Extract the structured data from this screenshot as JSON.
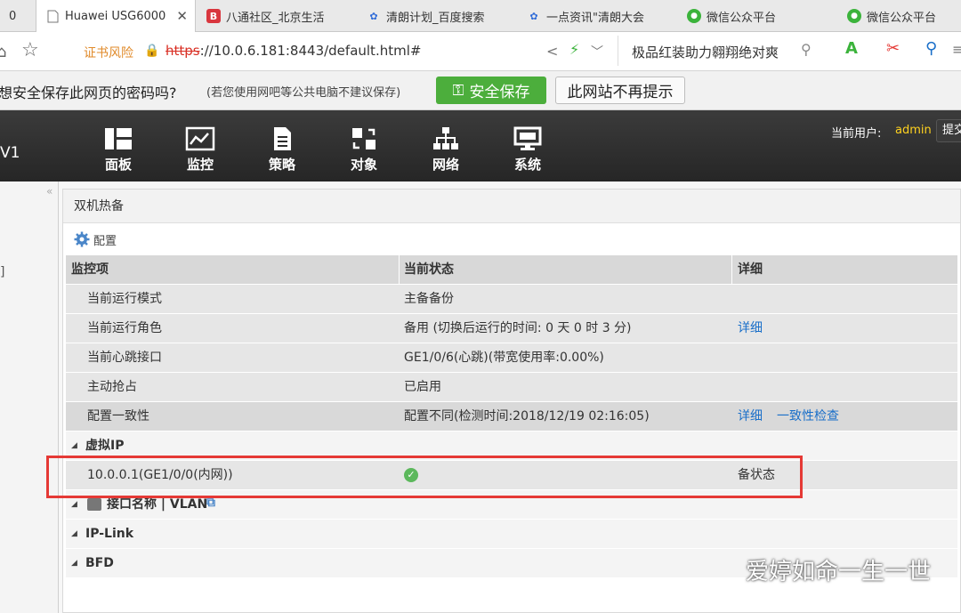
{
  "browser": {
    "tabs": [
      {
        "label": "0",
        "icon": "partial-tab-icon"
      },
      {
        "label": "Huawei USG6000",
        "icon": "page-icon",
        "active": true
      },
      {
        "label": "八通社区_北京生活",
        "icon": "b-logo-icon"
      },
      {
        "label": "清朗计划_百度搜索",
        "icon": "baidu-paw-icon"
      },
      {
        "label": "一点资讯\"清朗大会",
        "icon": "baidu-paw-icon"
      },
      {
        "label": "微信公众平台",
        "icon": "wechat-icon"
      },
      {
        "label": "微信公众平台",
        "icon": "wechat-icon"
      }
    ],
    "address": {
      "cert_warning": "证书风险",
      "scheme": "https",
      "url_rest": "://10.0.6.181:8443/default.html#",
      "search_text": "极品红装助力翱翔绝对爽"
    },
    "password_bar": {
      "question": "想安全保存此网页的密码吗?",
      "hint": "(若您使用网吧等公共电脑不建议保存)",
      "save_button": "安全保存",
      "never_button": "此网站不再提示"
    }
  },
  "app": {
    "version_fragment": "V1",
    "nav": [
      {
        "label": "面板",
        "icon": "dashboard-icon"
      },
      {
        "label": "监控",
        "icon": "monitor-chart-icon"
      },
      {
        "label": "策略",
        "icon": "policy-document-icon"
      },
      {
        "label": "对象",
        "icon": "object-icon"
      },
      {
        "label": "网络",
        "icon": "network-tree-icon"
      },
      {
        "label": "系统",
        "icon": "system-monitor-icon"
      }
    ],
    "user_label": "当前用户:",
    "user_name": "admin",
    "submit_fragment": "提交",
    "sidebar_fragment": "]"
  },
  "panel": {
    "title": "双机热备",
    "config_label": "配置",
    "headers": [
      "监控项",
      "当前状态",
      "详细"
    ],
    "rows": [
      {
        "item": "当前运行模式",
        "status": "主备备份",
        "detail": ""
      },
      {
        "item": "当前运行角色",
        "status": "备用 (切换后运行的时间: 0 天 0 时 3 分)",
        "detail": "详细"
      },
      {
        "item": "当前心跳接口",
        "status": "GE1/0/6(心跳)(带宽使用率:0.00%)",
        "detail": ""
      },
      {
        "item": "主动抢占",
        "status": "已启用",
        "detail": ""
      },
      {
        "item": "配置一致性",
        "status": "配置不同(检测时间:2018/12/19 02:16:05)",
        "detail": "详细",
        "detail2": "一致性检查"
      }
    ],
    "groups": {
      "vip": "虚拟IP",
      "vip_row": {
        "item": "10.0.0.1(GE1/0/0(内网))",
        "status_icon": "check-circle-icon",
        "detail": "备状态"
      },
      "iface": "接口名称 | VLAN",
      "iplink": "IP-Link",
      "bfd": "BFD"
    }
  },
  "watermark": "爱婷如命一生一世",
  "colors": {
    "accent_link": "#1a6fc9",
    "save_green": "#4cae3c",
    "highlight_red": "#e53935",
    "user_yellow": "#ffd21f"
  }
}
